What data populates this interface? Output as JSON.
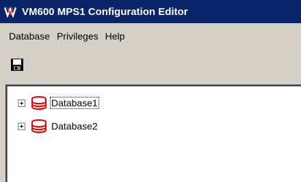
{
  "window": {
    "title": "VM600 MPS1 Configuration Editor",
    "logo_icon": "vm-logo-icon"
  },
  "menu": {
    "items": [
      {
        "label": "Database"
      },
      {
        "label": "Privileges"
      },
      {
        "label": "Help"
      }
    ]
  },
  "toolbar": {
    "save_icon": "save-disk-icon"
  },
  "tree": {
    "items": [
      {
        "label": "Database1",
        "icon": "database-icon",
        "selected": true,
        "expander": "plus"
      },
      {
        "label": "Database2",
        "icon": "database-icon",
        "selected": false,
        "expander": "plus"
      }
    ]
  },
  "colors": {
    "titlebar": "#0a246a",
    "database_icon": "#e00000",
    "window_bg": "#d4d0c8"
  }
}
